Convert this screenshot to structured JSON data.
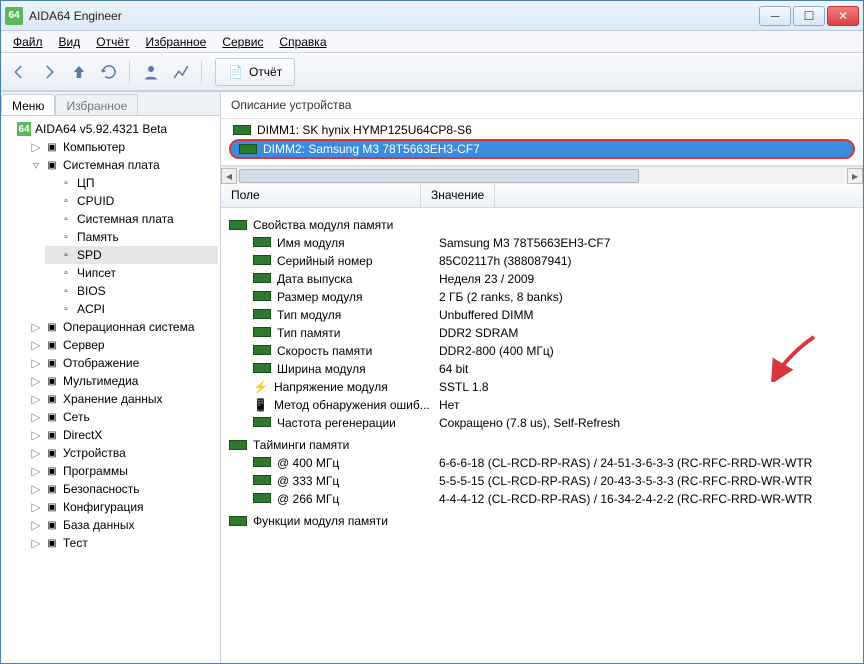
{
  "window": {
    "title": "AIDA64 Engineer",
    "icon_label": "64"
  },
  "menubar": [
    "Файл",
    "Вид",
    "Отчёт",
    "Избранное",
    "Сервис",
    "Справка"
  ],
  "toolbar": {
    "report_label": "Отчёт"
  },
  "left": {
    "tabs": [
      "Меню",
      "Избранное"
    ],
    "root": "AIDA64 v5.92.4321 Beta",
    "items": [
      {
        "label": "Компьютер",
        "twist": "▷"
      },
      {
        "label": "Системная плата",
        "twist": "▿",
        "children": [
          {
            "label": "ЦП"
          },
          {
            "label": "CPUID"
          },
          {
            "label": "Системная плата"
          },
          {
            "label": "Память"
          },
          {
            "label": "SPD",
            "sel": true
          },
          {
            "label": "Чипсет"
          },
          {
            "label": "BIOS"
          },
          {
            "label": "ACPI"
          }
        ]
      },
      {
        "label": "Операционная система",
        "twist": "▷"
      },
      {
        "label": "Сервер",
        "twist": "▷"
      },
      {
        "label": "Отображение",
        "twist": "▷"
      },
      {
        "label": "Мультимедиа",
        "twist": "▷"
      },
      {
        "label": "Хранение данных",
        "twist": "▷"
      },
      {
        "label": "Сеть",
        "twist": "▷"
      },
      {
        "label": "DirectX",
        "twist": "▷"
      },
      {
        "label": "Устройства",
        "twist": "▷"
      },
      {
        "label": "Программы",
        "twist": "▷"
      },
      {
        "label": "Безопасность",
        "twist": "▷"
      },
      {
        "label": "Конфигурация",
        "twist": "▷"
      },
      {
        "label": "База данных",
        "twist": "▷"
      },
      {
        "label": "Тест",
        "twist": "▷"
      }
    ]
  },
  "right": {
    "desc_header": "Описание устройства",
    "devices": [
      {
        "label": "DIMM1: SK hynix HYMP125U64CP8-S6"
      },
      {
        "label": "DIMM2: Samsung M3 78T5663EH3-CF7",
        "sel": true
      }
    ],
    "columns": [
      "Поле",
      "Значение"
    ],
    "groups": [
      {
        "title": "Свойства модуля памяти",
        "rows": [
          {
            "f": "Имя модуля",
            "v": "Samsung M3 78T5663EH3-CF7"
          },
          {
            "f": "Серийный номер",
            "v": "85C02117h (388087941)"
          },
          {
            "f": "Дата выпуска",
            "v": "Неделя 23 / 2009"
          },
          {
            "f": "Размер модуля",
            "v": "2 ГБ (2 ranks, 8 banks)"
          },
          {
            "f": "Тип модуля",
            "v": "Unbuffered DIMM"
          },
          {
            "f": "Тип памяти",
            "v": "DDR2 SDRAM"
          },
          {
            "f": "Скорость памяти",
            "v": "DDR2-800 (400 МГц)"
          },
          {
            "f": "Ширина модуля",
            "v": "64 bit"
          },
          {
            "f": "Напряжение модуля",
            "v": "SSTL 1.8",
            "icon": "volt"
          },
          {
            "f": "Метод обнаружения ошиб...",
            "v": "Нет",
            "icon": "err"
          },
          {
            "f": "Частота регенерации",
            "v": "Сокращено (7.8 us), Self-Refresh"
          }
        ]
      },
      {
        "title": "Тайминги памяти",
        "rows": [
          {
            "f": "@ 400 МГц",
            "v": "6-6-6-18  (CL-RCD-RP-RAS) / 24-51-3-6-3-3  (RC-RFC-RRD-WR-WTR"
          },
          {
            "f": "@ 333 МГц",
            "v": "5-5-5-15  (CL-RCD-RP-RAS) / 20-43-3-5-3-3  (RC-RFC-RRD-WR-WTR"
          },
          {
            "f": "@ 266 МГц",
            "v": "4-4-4-12  (CL-RCD-RP-RAS) / 16-34-2-4-2-2  (RC-RFC-RRD-WR-WTR"
          }
        ]
      },
      {
        "title": "Функции модуля памяти",
        "rows": []
      }
    ]
  }
}
